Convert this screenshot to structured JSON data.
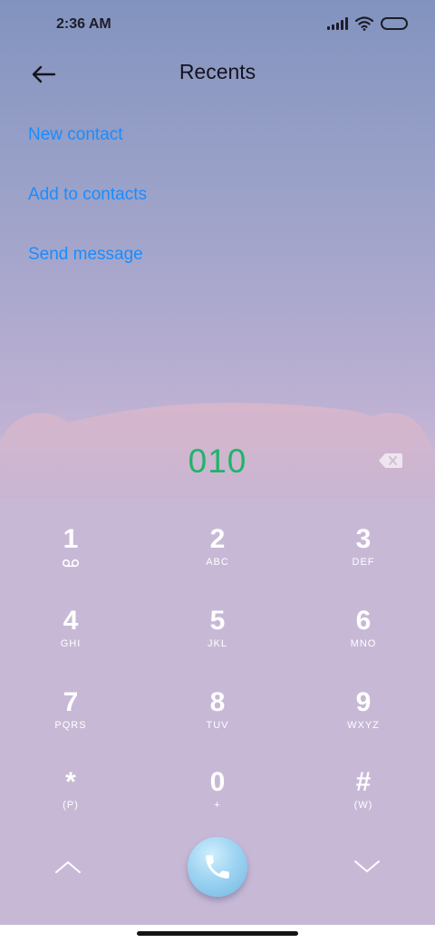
{
  "status_bar": {
    "time": "2:36 AM"
  },
  "header": {
    "title": "Recents",
    "back_icon": "back-arrow-icon"
  },
  "menu": {
    "items": [
      {
        "label": "New contact"
      },
      {
        "label": "Add to contacts"
      },
      {
        "label": "Send message"
      }
    ]
  },
  "dialer": {
    "number": "010",
    "delete_icon": "backspace-icon"
  },
  "keypad": {
    "keys": [
      {
        "digit": "1",
        "letters": ""
      },
      {
        "digit": "2",
        "letters": "ABC"
      },
      {
        "digit": "3",
        "letters": "DEF"
      },
      {
        "digit": "4",
        "letters": "GHI"
      },
      {
        "digit": "5",
        "letters": "JKL"
      },
      {
        "digit": "6",
        "letters": "MNO"
      },
      {
        "digit": "7",
        "letters": "PQRS"
      },
      {
        "digit": "8",
        "letters": "TUV"
      },
      {
        "digit": "9",
        "letters": "WXYZ"
      },
      {
        "digit": "*",
        "letters": "(P)"
      },
      {
        "digit": "0",
        "letters": "+"
      },
      {
        "digit": "#",
        "letters": "(W)"
      }
    ]
  },
  "bottom": {
    "up_icon": "chevron-up-icon",
    "call_icon": "phone-icon",
    "down_icon": "chevron-down-icon"
  },
  "colors": {
    "link": "#1a8cff",
    "number": "#1fb46a",
    "keypad_bg": "#c7b9d6"
  }
}
